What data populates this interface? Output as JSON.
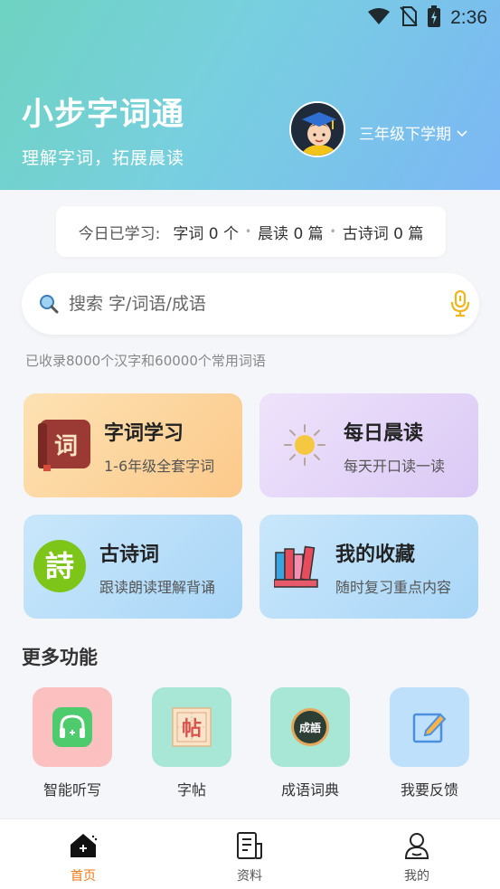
{
  "status_bar": {
    "time": "2:36"
  },
  "header": {
    "title": "小步字词通",
    "subtitle": "理解字词，拓展晨读",
    "grade": "三年级下学期"
  },
  "stats": {
    "label": "今日已学习:",
    "items": [
      "字词 0 个",
      "晨读 0 篇",
      "古诗词 0 篇"
    ]
  },
  "search": {
    "placeholder": "搜索 字/词语/成语"
  },
  "collection_note": "已收录8000个汉字和60000个常用词语",
  "cards": [
    {
      "title": "字词学习",
      "subtitle": "1-6年级全套字词",
      "icon": "dictionary-book-icon",
      "icon_char": "词"
    },
    {
      "title": "每日晨读",
      "subtitle": "每天开口读一读",
      "icon": "sun-icon"
    },
    {
      "title": "古诗词",
      "subtitle": "跟读朗读理解背诵",
      "icon": "poem-badge-icon",
      "icon_char": "詩"
    },
    {
      "title": "我的收藏",
      "subtitle": "随时复习重点内容",
      "icon": "bookshelf-icon"
    }
  ],
  "more_section_title": "更多功能",
  "more_functions": [
    {
      "label": "智能听写",
      "icon": "headphones-icon",
      "bg": "#fcc0c0"
    },
    {
      "label": "字帖",
      "icon": "copybook-icon",
      "icon_char": "帖",
      "bg": "#a8e6d6"
    },
    {
      "label": "成语词典",
      "icon": "idiom-dictionary-icon",
      "icon_char": "成語",
      "bg": "#a8e6d6"
    },
    {
      "label": "我要反馈",
      "icon": "feedback-edit-icon",
      "bg": "#bfe0fb"
    }
  ],
  "bottom_nav": [
    {
      "label": "首页",
      "icon": "home-icon",
      "active": true
    },
    {
      "label": "资料",
      "icon": "document-icon",
      "active": false
    },
    {
      "label": "我的",
      "icon": "profile-icon",
      "active": false
    }
  ],
  "colors": {
    "accent": "#f07a16",
    "header_gradient": [
      "#6ed3c1",
      "#7cb7f5"
    ]
  }
}
